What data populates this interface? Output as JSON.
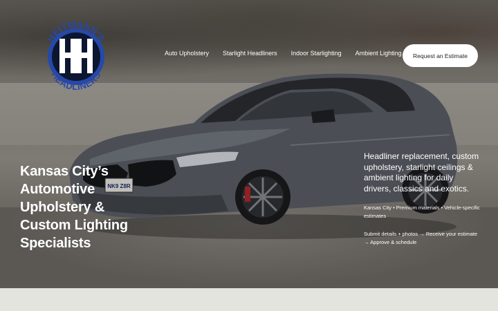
{
  "brand": {
    "logo_text_top": "HEITMANN'S",
    "logo_text_bottom": "HEADLINERS",
    "primary_color": "#2648a8",
    "dark_color": "#0c1630"
  },
  "nav": {
    "items": [
      {
        "label": "Auto Upholstery"
      },
      {
        "label": "Starlight Headliners"
      },
      {
        "label": "Indoor Starlighting"
      },
      {
        "label": "Ambient Lighting"
      }
    ],
    "cta_label": "Request an Estimate"
  },
  "hero": {
    "headline": "Kansas City’s Automotive Upholstery & Custom Lighting Specialists",
    "tagline": "Headliner replacement, custom upholstery, starlight ceilings & ambient lighting for daily drivers, classics and exotics.",
    "meta": "Kansas City • Premium materials • Vehicle-specific estimates",
    "steps": "Submit details + photos → Receive your estimate → Approve & schedule",
    "plate": "NK9 Z8R"
  }
}
